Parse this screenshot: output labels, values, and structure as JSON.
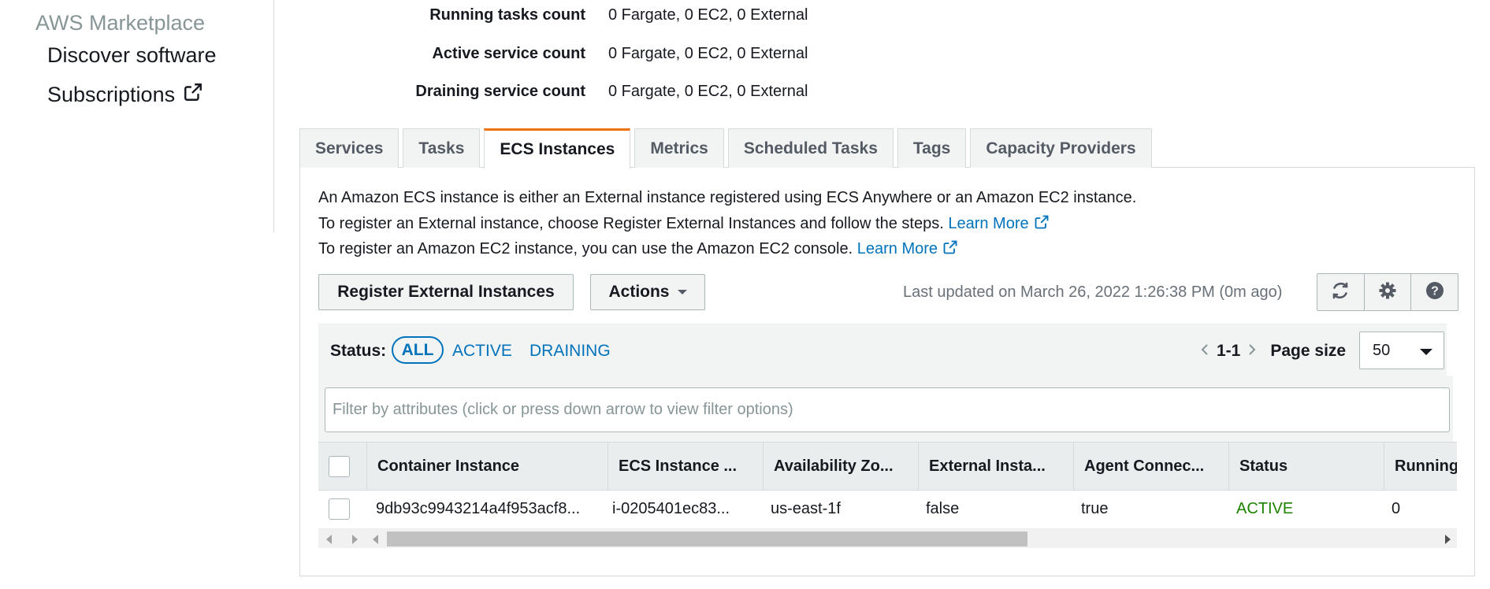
{
  "sidebar": {
    "heading": "AWS Marketplace",
    "items": [
      {
        "label": "Discover software"
      },
      {
        "label": "Subscriptions"
      }
    ]
  },
  "summary": [
    {
      "label": "Running tasks count",
      "value": "0 Fargate, 0 EC2, 0 External"
    },
    {
      "label": "Active service count",
      "value": "0 Fargate, 0 EC2, 0 External"
    },
    {
      "label": "Draining service count",
      "value": "0 Fargate, 0 EC2, 0 External"
    }
  ],
  "tabs": [
    {
      "label": "Services"
    },
    {
      "label": "Tasks"
    },
    {
      "label": "ECS Instances",
      "active": true
    },
    {
      "label": "Metrics"
    },
    {
      "label": "Scheduled Tasks"
    },
    {
      "label": "Tags"
    },
    {
      "label": "Capacity Providers"
    }
  ],
  "description": {
    "line1": "An Amazon ECS instance is either an External instance registered using ECS Anywhere or an Amazon EC2 instance.",
    "line2": "To register an External instance, choose Register External Instances and follow the steps.",
    "line3": "To register an Amazon EC2 instance, you can use the Amazon EC2 console.",
    "learn_more": "Learn More"
  },
  "toolbar": {
    "register_label": "Register External Instances",
    "actions_label": "Actions",
    "last_updated": "Last updated on March 26, 2022 1:26:38 PM (0m ago)",
    "icons": [
      "refresh-icon",
      "gear-icon",
      "help-icon"
    ]
  },
  "status_filter": {
    "label": "Status:",
    "options": [
      "ALL",
      "ACTIVE",
      "DRAINING"
    ],
    "selected": "ALL"
  },
  "pagination": {
    "range": "1-1",
    "page_size_label": "Page size",
    "page_size": "50"
  },
  "filter": {
    "placeholder": "Filter by attributes (click or press down arrow to view filter options)"
  },
  "table": {
    "columns": [
      "Container Instance",
      "ECS Instance ...",
      "Availability Zo...",
      "External Insta...",
      "Agent Connec...",
      "Status",
      "Running"
    ],
    "rows": [
      [
        "9db93c9943214a4f953acf8...",
        "i-0205401ec83...",
        "us-east-1f",
        "false",
        "true",
        "ACTIVE",
        "0"
      ]
    ]
  },
  "colors": {
    "link": "#0073bb",
    "active_tab_accent": "#ec7211",
    "status_active": "#1d8102"
  }
}
